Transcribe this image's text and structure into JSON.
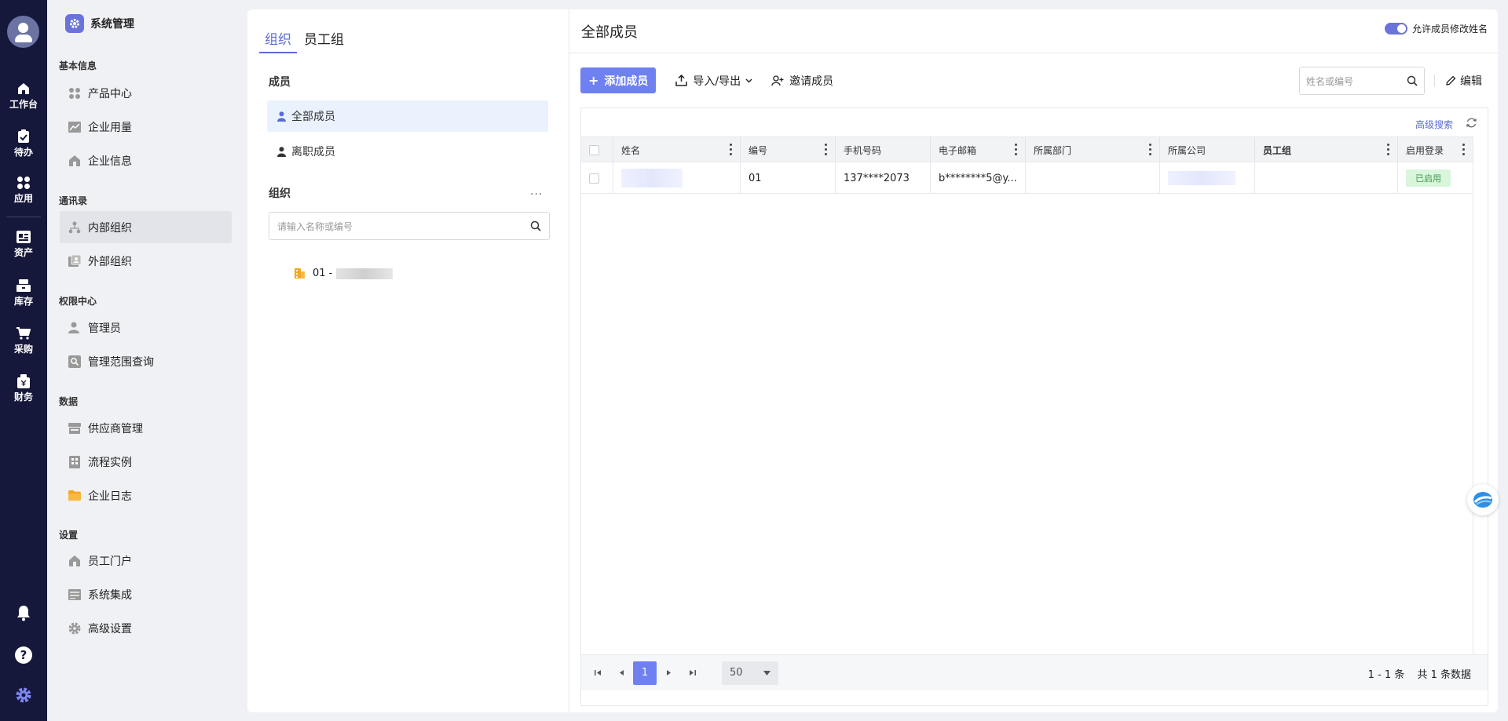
{
  "rail": {
    "items": [
      {
        "label": "工作台",
        "icon": "home-icon"
      },
      {
        "label": "待办",
        "icon": "clipboard-check-icon"
      },
      {
        "label": "应用",
        "icon": "apps-grid-icon"
      },
      {
        "label": "资产",
        "icon": "asset-card-icon"
      },
      {
        "label": "库存",
        "icon": "warehouse-icon"
      },
      {
        "label": "采购",
        "icon": "cart-icon"
      },
      {
        "label": "财务",
        "icon": "finance-bag-icon"
      }
    ],
    "bottom": [
      "bell-icon",
      "help-icon",
      "settings-gear-icon"
    ]
  },
  "sidebar": {
    "title": "系统管理",
    "sections": [
      {
        "title": "基本信息",
        "items": [
          "产品中心",
          "企业用量",
          "企业信息"
        ]
      },
      {
        "title": "通讯录",
        "items": [
          "内部组织",
          "外部组织"
        ]
      },
      {
        "title": "权限中心",
        "items": [
          "管理员",
          "管理范围查询"
        ]
      },
      {
        "title": "数据",
        "items": [
          "供应商管理",
          "流程实例",
          "企业日志"
        ]
      },
      {
        "title": "设置",
        "items": [
          "员工门户",
          "系统集成",
          "高级设置"
        ]
      }
    ],
    "active": "内部组织"
  },
  "org_panel": {
    "tabs": [
      "组织",
      "员工组"
    ],
    "members_label": "成员",
    "member_items": [
      "全部成员",
      "离职成员"
    ],
    "org_label": "组织",
    "more": "···",
    "search_placeholder": "请输入名称或编号",
    "tree_node_prefix": "01 -"
  },
  "members": {
    "title": "全部成员",
    "toggle_label": "允许成员修改姓名",
    "add_btn": "添加成员",
    "import_export": "导入/导出",
    "invite": "邀请成员",
    "search_placeholder": "姓名或编号",
    "edit": "编辑",
    "advanced_search": "高级搜索",
    "columns": [
      "姓名",
      "编号",
      "手机号码",
      "电子邮箱",
      "所属部门",
      "所属公司",
      "员工组",
      "启用登录"
    ],
    "rows": [
      {
        "name": "",
        "code": "01",
        "phone": "137****2073",
        "email": "b********5@y...",
        "dept": "",
        "company": "",
        "group": "",
        "login": "已启用"
      }
    ]
  },
  "pager": {
    "current_page": "1",
    "page_size": "50",
    "range": "1 - 1 条",
    "total": "共 1 条数据"
  },
  "colors": {
    "rail_bg": "#15183a",
    "accent": "#6f80f0",
    "enabled_badge_bg": "#d9f5dc"
  }
}
